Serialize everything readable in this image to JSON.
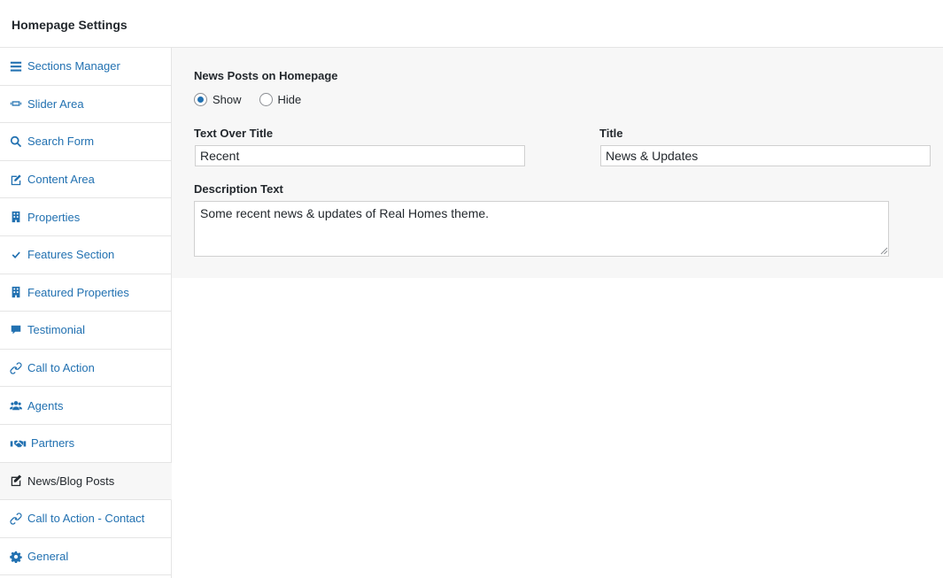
{
  "header": {
    "title": "Homepage Settings"
  },
  "sidebar": {
    "items": [
      {
        "label": "Sections Manager",
        "icon": "menu-icon"
      },
      {
        "label": "Slider Area",
        "icon": "slider-icon"
      },
      {
        "label": "Search Form",
        "icon": "search-icon"
      },
      {
        "label": "Content Area",
        "icon": "edit-icon"
      },
      {
        "label": "Properties",
        "icon": "building-icon"
      },
      {
        "label": "Features Section",
        "icon": "checkmark-icon"
      },
      {
        "label": "Featured Properties",
        "icon": "building-icon"
      },
      {
        "label": "Testimonial",
        "icon": "speech-bubble-icon"
      },
      {
        "label": "Call to Action",
        "icon": "link-icon"
      },
      {
        "label": "Agents",
        "icon": "users-icon"
      },
      {
        "label": "Partners",
        "icon": "handshake-icon"
      },
      {
        "label": "News/Blog Posts",
        "icon": "edit-square-icon",
        "active": true
      },
      {
        "label": "Call to Action - Contact",
        "icon": "link-icon"
      },
      {
        "label": "General",
        "icon": "gear-icon"
      }
    ]
  },
  "main": {
    "news_posts": {
      "label": "News Posts on Homepage",
      "options": [
        "Show",
        "Hide"
      ],
      "selected": "Show"
    },
    "text_over_title": {
      "label": "Text Over Title",
      "value": "Recent"
    },
    "title": {
      "label": "Title",
      "value": "News & Updates"
    },
    "description": {
      "label": "Description Text",
      "value": "Some recent news & updates of Real Homes theme."
    }
  },
  "colors": {
    "link": "#2271b1",
    "text": "#23282d",
    "panel": "#f7f7f7",
    "border": "#e5e5e5"
  }
}
